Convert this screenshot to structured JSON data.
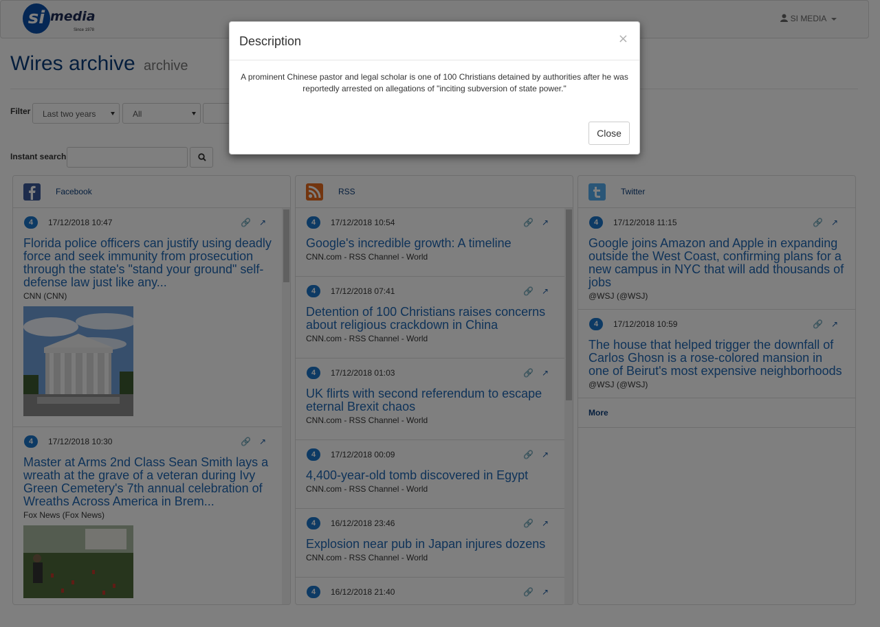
{
  "brand": {
    "name_mark": "si",
    "name_text": "media",
    "since": "Since 1978"
  },
  "user_menu": {
    "label": "SI MEDIA"
  },
  "header": {
    "title": "Wires archive",
    "subtitle": "archive"
  },
  "filters": {
    "label": "Filter",
    "period": "Last two years",
    "category": "All"
  },
  "search": {
    "label": "Instant search",
    "placeholder": ""
  },
  "columns": {
    "facebook": {
      "title": "Facebook",
      "items": [
        {
          "badge": "4",
          "date": "17/12/2018 10:47",
          "title": "Florida police officers can justify using deadly force and seek immunity from prosecution through the state's \"stand your ground\" self-defense law just like any...",
          "source": "CNN (CNN)"
        },
        {
          "badge": "4",
          "date": "17/12/2018 10:30",
          "title": "Master at Arms 2nd Class Sean Smith lays a wreath at the grave of a veteran during Ivy Green Cemetery's 7th annual celebration of Wreaths Across America in Brem...",
          "source": "Fox News (Fox News)"
        }
      ]
    },
    "rss": {
      "title": "RSS",
      "items": [
        {
          "badge": "4",
          "date": "17/12/2018 10:54",
          "title": "Google's incredible growth: A timeline",
          "source": "CNN.com - RSS Channel - World"
        },
        {
          "badge": "4",
          "date": "17/12/2018 07:41",
          "title": "Detention of 100 Christians raises concerns about religious crackdown in China",
          "source": "CNN.com - RSS Channel - World"
        },
        {
          "badge": "4",
          "date": "17/12/2018 01:03",
          "title": "UK flirts with second referendum to escape eternal Brexit chaos",
          "source": "CNN.com - RSS Channel - World"
        },
        {
          "badge": "4",
          "date": "17/12/2018 00:09",
          "title": "4,400-year-old tomb discovered in Egypt",
          "source": "CNN.com - RSS Channel - World"
        },
        {
          "badge": "4",
          "date": "16/12/2018 23:46",
          "title": "Explosion near pub in Japan injures dozens",
          "source": "CNN.com - RSS Channel - World"
        },
        {
          "badge": "4",
          "date": "16/12/2018 21:40",
          "title": "",
          "source": ""
        }
      ]
    },
    "twitter": {
      "title": "Twitter",
      "items": [
        {
          "badge": "4",
          "date": "17/12/2018 11:15",
          "title": "Google joins Amazon and Apple in expanding outside the West Coast, confirming plans for a new campus in NYC that will add thousands of jobs",
          "source": "@WSJ (@WSJ)"
        },
        {
          "badge": "4",
          "date": "17/12/2018 10:59",
          "title": "The house that helped trigger the downfall of Carlos Ghosn is a rose-colored mansion in one of Beirut's most expensive neighborhoods",
          "source": "@WSJ (@WSJ)"
        }
      ],
      "more_label": "More"
    }
  },
  "modal": {
    "title": "Description",
    "close_x": "×",
    "body": "A prominent Chinese pastor and legal scholar is one of 100 Christians detained by authorities after he was reportedly arrested on allegations of \"inciting subversion of state power.\"",
    "close_button": "Close"
  },
  "colors": {
    "accent": "#1f66b3",
    "badge": "#1a74c9",
    "title": "#0b3d7a",
    "facebook": "#3b5998",
    "rss": "#e66a1f",
    "twitter": "#55acee"
  }
}
